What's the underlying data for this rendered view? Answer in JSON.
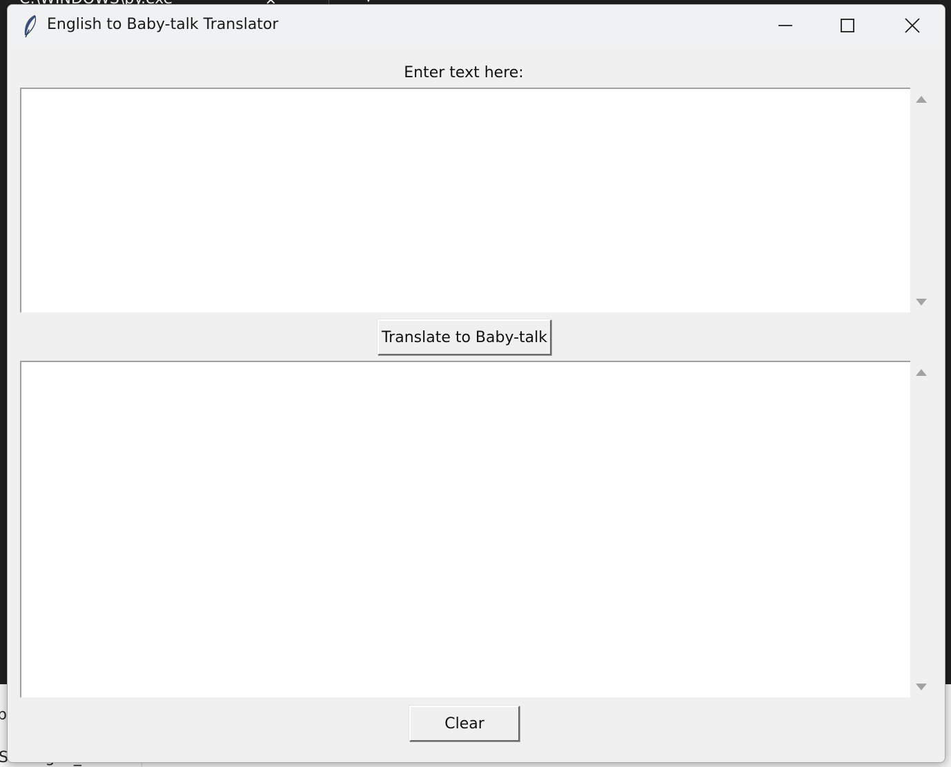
{
  "background": {
    "top_window_title": "C:\\WINDOWS\\py.exe",
    "bottom_left_letter": "p",
    "bottom_text": "Schengen_NL"
  },
  "window": {
    "title": "English to Baby-talk Translator",
    "icon": "feather-icon",
    "controls": {
      "minimize_icon": "minimize-icon",
      "maximize_icon": "maximize-icon",
      "close_icon": "close-icon"
    }
  },
  "input": {
    "label": "Enter text here:",
    "value": ""
  },
  "actions": {
    "translate_label": "Translate to Baby-talk",
    "clear_label": "Clear"
  },
  "output": {
    "value": ""
  },
  "colors": {
    "window_bg": "#f0f0f0",
    "titlebar_bg": "#eff1f2",
    "textbox_bg": "#ffffff",
    "icon_feather": "#3a4f7a"
  }
}
